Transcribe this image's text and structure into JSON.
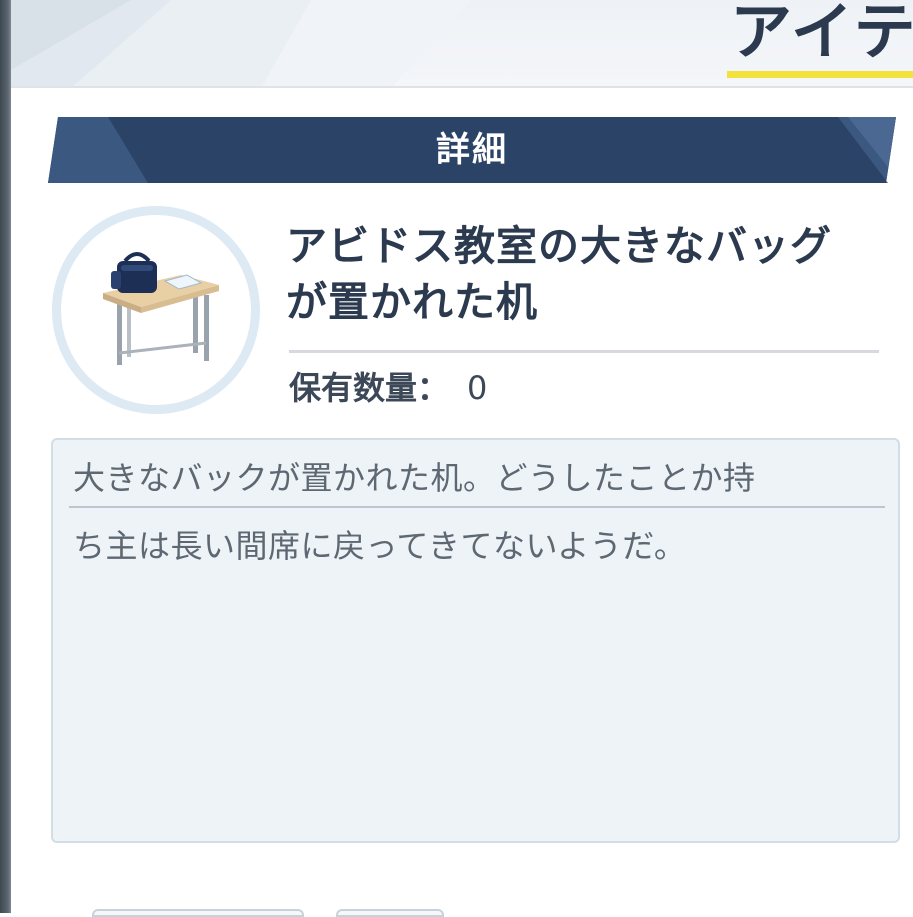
{
  "window": {
    "title": "アイテ"
  },
  "detail_section": {
    "title": "詳細"
  },
  "item": {
    "name_line1": "アビドス教室の大きなバッグ",
    "name_line2": "が置かれた机",
    "icon": "desk-with-bag-icon",
    "quantity_label": "保有数量",
    "quantity_separator": "：",
    "quantity_value": "0"
  },
  "description": {
    "line1": "大きなバックが置かれた机。どうしたことか持",
    "line2": "ち主は長い間席に戻ってきてないようだ。"
  },
  "colors": {
    "accent_navy": "#2b4366",
    "title_underline": "#f2e33c",
    "text_dark": "#2b3a4f",
    "description_bg": "#eef3f8"
  }
}
